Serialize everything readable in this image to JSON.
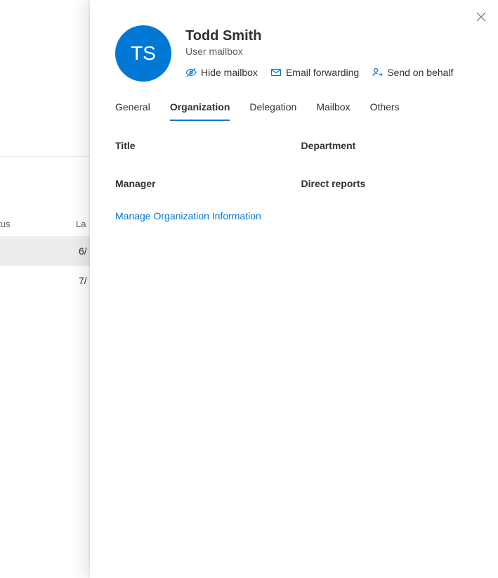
{
  "background": {
    "col_status": "atus",
    "col_last": "La",
    "rows": [
      {
        "date": "6/"
      },
      {
        "date": "7/"
      }
    ]
  },
  "panel": {
    "avatar_initials": "TS",
    "name": "Todd Smith",
    "subtitle": "User mailbox",
    "actions": {
      "hide_mailbox": "Hide mailbox",
      "email_forwarding": "Email forwarding",
      "send_on_behalf": "Send on behalf"
    },
    "tabs": {
      "general": "General",
      "organization": "Organization",
      "delegation": "Delegation",
      "mailbox": "Mailbox",
      "others": "Others"
    },
    "org": {
      "title_label": "Title",
      "department_label": "Department",
      "manager_label": "Manager",
      "direct_reports_label": "Direct reports",
      "manage_link": "Manage Organization Information"
    }
  }
}
